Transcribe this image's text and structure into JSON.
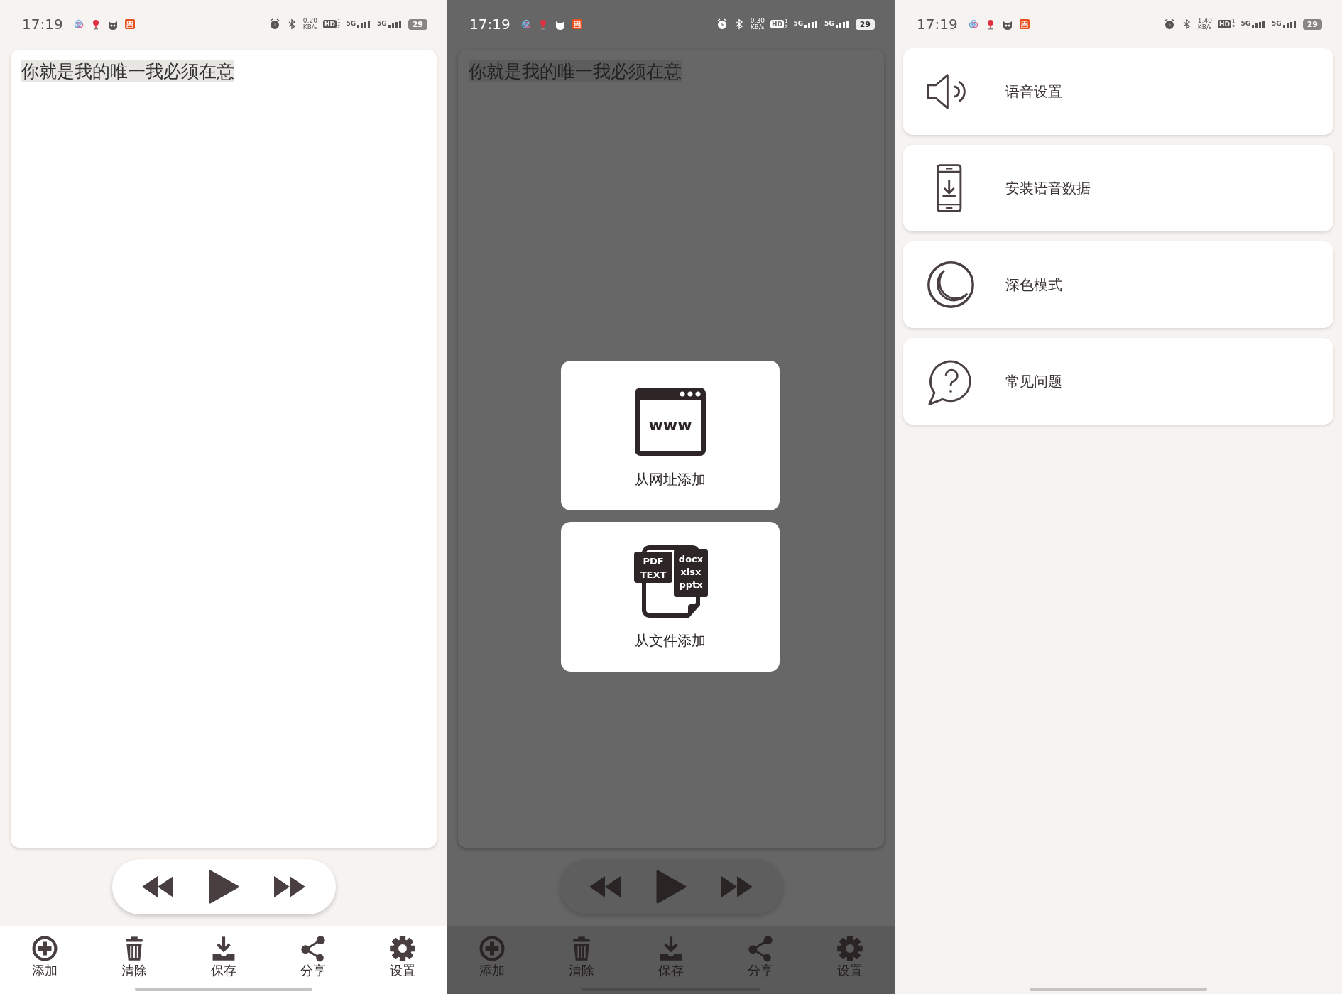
{
  "screens": [
    {
      "kind": "editor",
      "dimmed": false,
      "status_bar": {
        "time": "17:19",
        "speed": "0.20",
        "speed_unit": "KB/s",
        "hd": "HD",
        "hd_sims": [
          "1",
          "2"
        ],
        "networks": [
          "5G",
          "5G"
        ],
        "battery": "29"
      },
      "text": "你就是我的唯一我必须在意",
      "toolbar": [
        {
          "label": "添加"
        },
        {
          "label": "清除"
        },
        {
          "label": "保存"
        },
        {
          "label": "分享"
        },
        {
          "label": "设置"
        }
      ]
    },
    {
      "kind": "editor",
      "dimmed": true,
      "status_bar": {
        "time": "17:19",
        "speed": "0.30",
        "speed_unit": "KB/s",
        "hd": "HD",
        "hd_sims": [
          "1",
          "2"
        ],
        "networks": [
          "5G",
          "5G"
        ],
        "battery": "29"
      },
      "text": "你就是我的唯一我必须在意",
      "toolbar": [
        {
          "label": "添加"
        },
        {
          "label": "清除"
        },
        {
          "label": "保存"
        },
        {
          "label": "分享"
        },
        {
          "label": "设置"
        }
      ],
      "dialog": {
        "options": [
          {
            "kind": "url",
            "icon_text": [
              "www"
            ],
            "label": "从网址添加"
          },
          {
            "kind": "file",
            "icon_text": [
              "PDF",
              "TEXT",
              "docx",
              "xlsx",
              "pptx"
            ],
            "label": "从文件添加"
          }
        ]
      }
    },
    {
      "kind": "settings",
      "dimmed": false,
      "status_bar": {
        "time": "17:19",
        "speed": "1.40",
        "speed_unit": "KB/s",
        "hd": "HD",
        "hd_sims": [
          "1",
          "2"
        ],
        "networks": [
          "5G",
          "5G"
        ],
        "battery": "29"
      },
      "menu": [
        {
          "label": "语音设置"
        },
        {
          "label": "安装语音数据"
        },
        {
          "label": "深色模式"
        },
        {
          "label": "常见问题"
        }
      ]
    }
  ]
}
